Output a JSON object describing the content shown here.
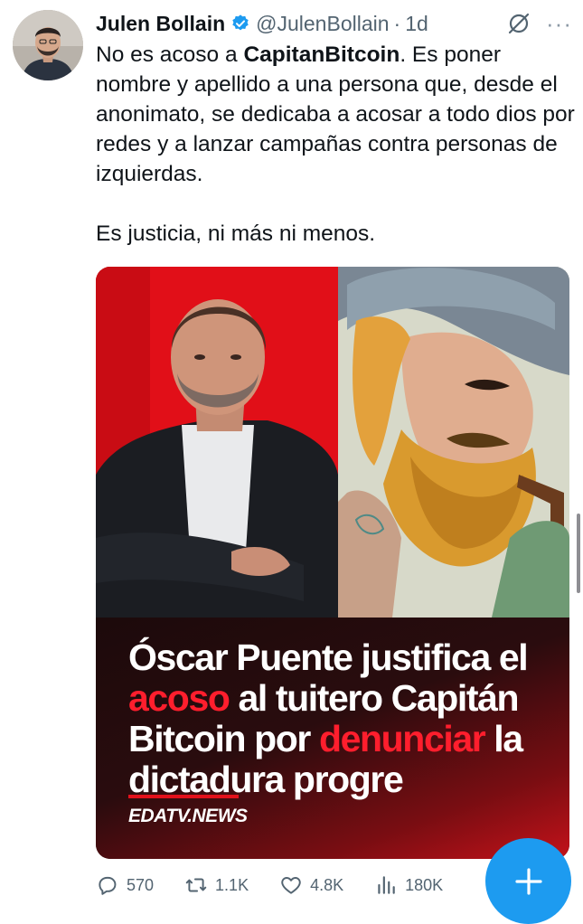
{
  "tweet": {
    "author": {
      "display_name": "Julen Bollain",
      "handle": "@JulenBollain",
      "verified": true,
      "avatar_icon": "avatar-photo"
    },
    "separator": "·",
    "time": "1d",
    "header_icons": [
      "no-circle-icon",
      "more-icon"
    ],
    "more_label": "···",
    "text": {
      "line1_prefix": "No es acoso a ",
      "line1_mention": "CapitanBitcoin",
      "line1_suffix": ". Es poner nombre y apellido a una persona que, desde el anonimato, se dedicaba a acosar a todo dios por redes y a lanzar campañas contra personas de izquierdas.",
      "line2": "Es justicia, ni más ni menos."
    },
    "media": {
      "headline": {
        "part1": "Óscar Puente justifica el",
        "highlight1": "acoso",
        "part2": " al tuitero Capitán Bitcoin por ",
        "highlight2": "denunciar",
        "part3": " la dictadura progre"
      },
      "brand": "EDATV.NEWS",
      "colors": {
        "accent_red": "#ff1e2d",
        "brand_bar": "#e3111b",
        "photo_left_bg": "#e10f18"
      }
    },
    "actions": [
      {
        "name": "reply",
        "icon": "reply-icon",
        "count": "570"
      },
      {
        "name": "retweet",
        "icon": "retweet-icon",
        "count": "1.1K"
      },
      {
        "name": "like",
        "icon": "heart-icon",
        "count": "4.8K"
      },
      {
        "name": "views",
        "icon": "views-icon",
        "count": "180K"
      }
    ]
  },
  "fab": {
    "icon": "plus-icon",
    "color": "#1d9bf0"
  }
}
